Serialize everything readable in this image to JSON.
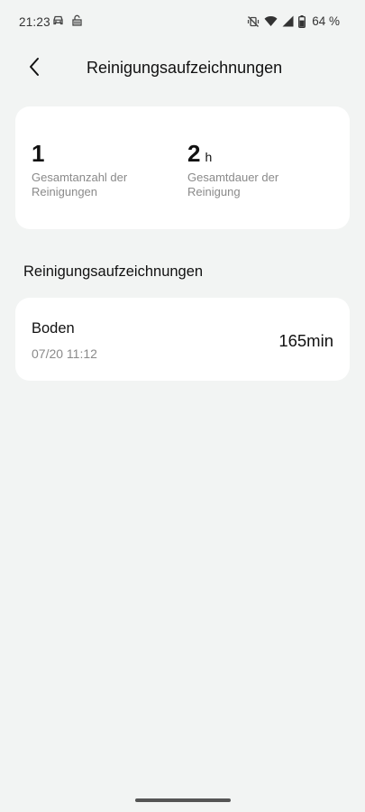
{
  "status_bar": {
    "time": "21:23",
    "battery": "64 %",
    "icons": [
      "car-icon",
      "lock-open-icon",
      "mute-vibrate-icon",
      "wifi-icon",
      "signal-icon",
      "battery-icon"
    ]
  },
  "header": {
    "title": "Reinigungsaufzeichnungen",
    "back_icon": "chevron-left-icon"
  },
  "summary": {
    "total_count": {
      "value": "1",
      "unit": "",
      "label": "Gesamtanzahl der Reinigungen"
    },
    "total_duration": {
      "value": "2",
      "unit": "h",
      "label": "Gesamtdauer der Reinigung"
    }
  },
  "records_section": {
    "heading": "Reinigungsaufzeichnungen",
    "items": [
      {
        "name": "Boden",
        "date": "07/20 11:12",
        "duration": "165min"
      }
    ]
  },
  "colors": {
    "background": "#f2f4f3",
    "card": "#ffffff",
    "secondary_text": "#8a8a8a"
  }
}
